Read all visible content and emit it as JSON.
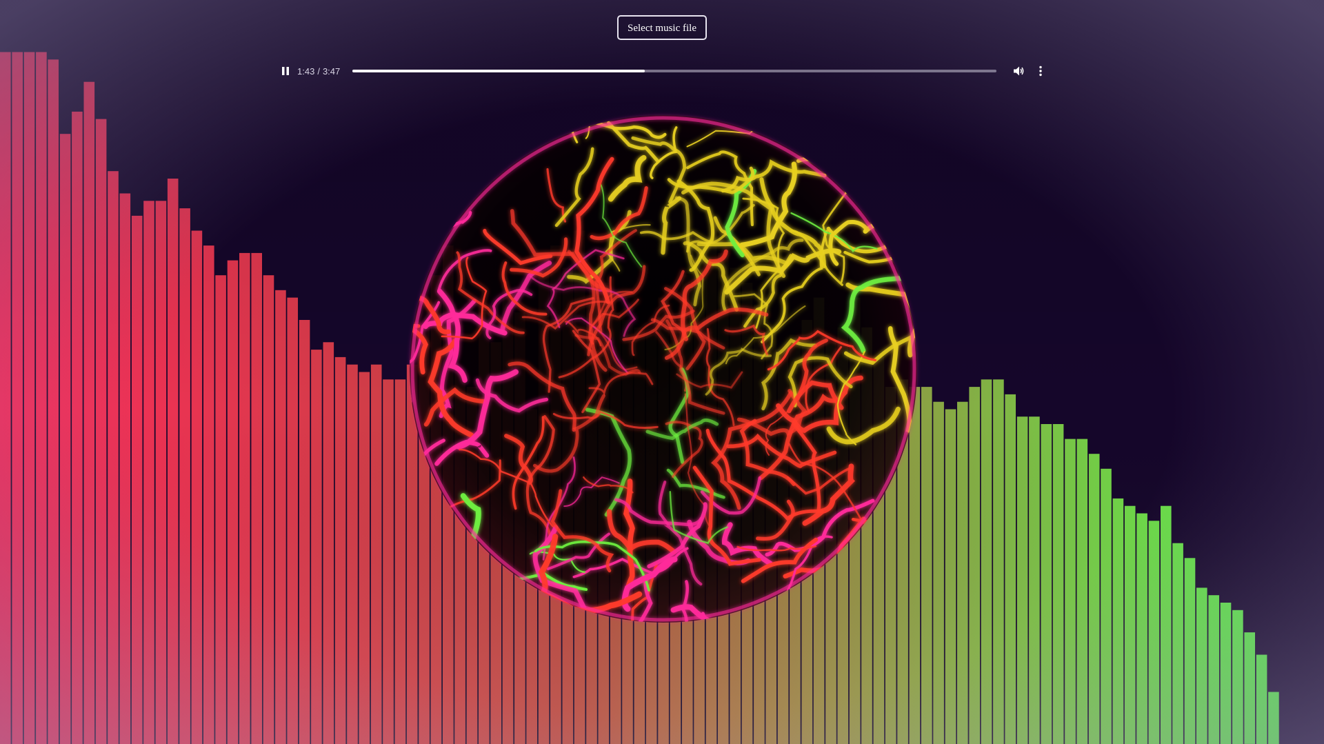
{
  "toolbar": {
    "select_file_label": "Select music file"
  },
  "player": {
    "state": "playing",
    "current_time": "1:43",
    "separator": "/",
    "duration": "3:47",
    "progress_fraction": 0.4537,
    "play_pause_icon": "pause-icon",
    "volume_icon": "volume-icon",
    "menu_icon": "more-vertical-icon"
  },
  "visualizer": {
    "background_color": "#15062a",
    "bar_start_color": "#ff2a5a",
    "bar_end_color": "#5cff4a",
    "orb_colors": [
      "#ff2a9a",
      "#ff3a2a",
      "#e8d020",
      "#6ef040"
    ],
    "bar_levels": [
      0.93,
      0.93,
      0.93,
      0.93,
      0.92,
      0.82,
      0.85,
      0.89,
      0.84,
      0.77,
      0.74,
      0.71,
      0.73,
      0.73,
      0.76,
      0.72,
      0.69,
      0.67,
      0.63,
      0.65,
      0.66,
      0.66,
      0.63,
      0.61,
      0.6,
      0.57,
      0.53,
      0.54,
      0.52,
      0.51,
      0.5,
      0.51,
      0.49,
      0.49,
      0.51,
      0.56,
      0.63,
      0.67,
      0.5,
      0.48,
      0.58,
      0.54,
      0.6,
      0.58,
      0.45,
      0.66,
      0.67,
      0.64,
      0.69,
      0.6,
      0.62,
      0.58,
      0.57,
      0.56,
      0.55,
      0.6,
      0.57,
      0.63,
      0.65,
      0.67,
      0.66,
      0.64,
      0.62,
      0.59,
      0.56,
      0.53,
      0.55,
      0.57,
      0.6,
      0.54,
      0.56,
      0.6,
      0.56,
      0.52,
      0.48,
      0.49,
      0.48,
      0.48,
      0.46,
      0.45,
      0.46,
      0.48,
      0.49,
      0.49,
      0.47,
      0.44,
      0.44,
      0.43,
      0.43,
      0.41,
      0.41,
      0.39,
      0.37,
      0.33,
      0.32,
      0.31,
      0.3,
      0.32,
      0.27,
      0.25,
      0.21,
      0.2,
      0.19,
      0.18,
      0.15,
      0.12,
      0.07
    ]
  }
}
